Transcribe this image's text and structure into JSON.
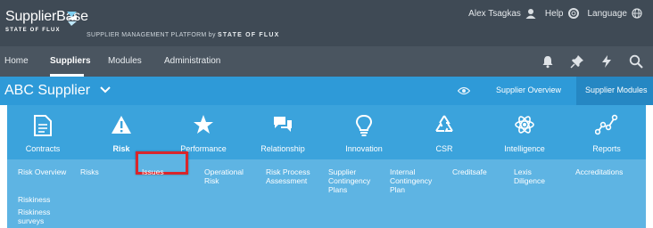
{
  "header": {
    "logo_text": "SupplierBase",
    "logo_sub": "STATE OF FLUX",
    "platform_text": "SUPPLIER MANAGEMENT PLATFORM by",
    "platform_brand": "STATE OF FLUX",
    "user_name": "Alex Tsagkas",
    "help_label": "Help",
    "language_label": "Language"
  },
  "nav": {
    "items": [
      {
        "label": "Home"
      },
      {
        "label": "Suppliers"
      },
      {
        "label": "Modules"
      },
      {
        "label": "Administration"
      }
    ],
    "icons": [
      "bell-icon",
      "pin-icon",
      "bolt-icon",
      "search-icon"
    ]
  },
  "supplier": {
    "title": "ABC Supplier",
    "overview_label": "Supplier Overview",
    "modules_label": "Supplier Modules"
  },
  "modules": [
    {
      "label": "Contracts",
      "icon": "document-icon"
    },
    {
      "label": "Risk",
      "icon": "warning-icon"
    },
    {
      "label": "Performance",
      "icon": "star-icon"
    },
    {
      "label": "Relationship",
      "icon": "chat-icon"
    },
    {
      "label": "Innovation",
      "icon": "lightbulb-icon"
    },
    {
      "label": "CSR",
      "icon": "recycle-icon"
    },
    {
      "label": "Intelligence",
      "icon": "atom-icon"
    },
    {
      "label": "Reports",
      "icon": "graph-icon"
    }
  ],
  "risk_sub": {
    "risk_overview": "Risk Overview",
    "risks": "Risks",
    "issues": "Issues",
    "operational_risk": "Operational Risk",
    "risk_process_assessment": "Risk Process Assessment",
    "supplier_contingency_plans": "Supplier Contingency Plans",
    "internal_contingency_plan": "Internal Contingency Plan",
    "creditsafe": "Creditsafe",
    "lexis_diligence": "Lexis Diligence",
    "accreditations": "Accreditations",
    "riskiness": "Riskiness",
    "riskiness_surveys": "Riskiness surveys"
  },
  "colors": {
    "header_bg": "#3f4a55",
    "nav_bg": "#4a5560",
    "supplier_bar": "#2e9ad8",
    "panel": "#3ba3dc",
    "highlight": "#d8262c"
  }
}
